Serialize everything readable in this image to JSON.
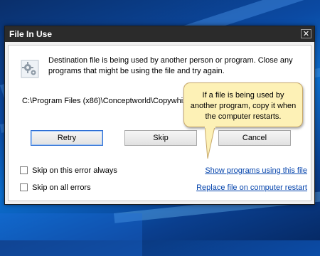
{
  "dialog": {
    "title": "File In Use",
    "close_symbol": "✕",
    "message": "Destination file is being used by another person or program. Close any programs that might be using the file and try again.",
    "path": "C:\\Program Files (x86)\\Conceptworld\\Copywhiz",
    "buttons": {
      "retry": "Retry",
      "skip": "Skip",
      "cancel": "Cancel"
    },
    "options": {
      "skip_error_always": "Skip on this error always",
      "skip_all_errors": "Skip on all errors"
    },
    "links": {
      "show_programs": "Show programs using this file",
      "replace_on_restart": "Replace file on computer restart"
    }
  },
  "tooltip": {
    "text": "If a file is being used by another program, copy it when the computer restarts."
  },
  "icons": {
    "gear": "gear-icon"
  }
}
